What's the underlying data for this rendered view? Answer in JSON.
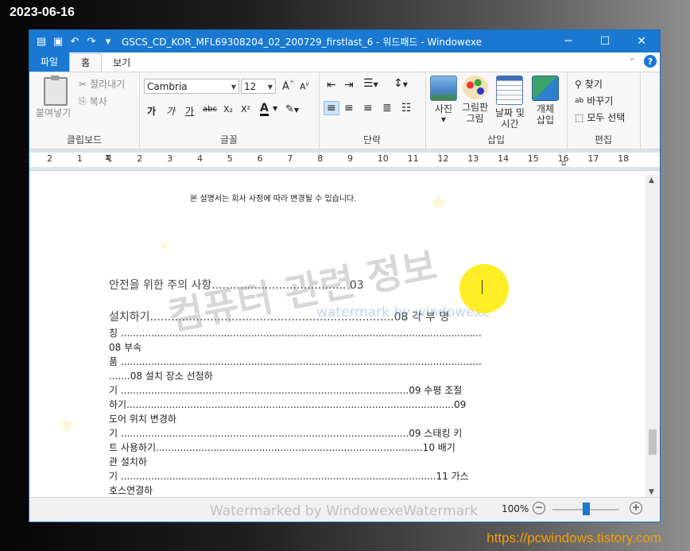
{
  "overlay": {
    "date": "2023-06-16",
    "site": "https://pcwindows.tistory.com",
    "watermark_big": "컴퓨터 관련 정보",
    "watermark_blue": "watermark by windowexe",
    "watermark_bottom": "Watermarked by WindowexeWatermark"
  },
  "window": {
    "title": "GSCS_CD_KOR_MFL69308204_02_200729_firstlast_6 - 워드패드    - Windowexe"
  },
  "icons": {
    "save": "save-icon",
    "undo": "undo-icon",
    "redo": "redo-icon",
    "minimize": "minimize-icon",
    "maximize": "maximize-icon",
    "close": "close-icon"
  },
  "tabs": [
    {
      "label": "파일"
    },
    {
      "label": "홈"
    },
    {
      "label": "보기"
    }
  ],
  "ribbon": {
    "clipboard": {
      "paste": "붙여넣기",
      "cut": "잘라내기",
      "copy": "복사",
      "label": "클립보드"
    },
    "font": {
      "family": "Cambria",
      "size": "12",
      "bold": "가",
      "italic": "가",
      "underline": "가",
      "strike": "abc",
      "subscript": "X₂",
      "superscript": "X²",
      "color": "A",
      "label": "글꼴"
    },
    "paragraph": {
      "label": "단락"
    },
    "insert": {
      "picture": "사진",
      "paint_line1": "그림판",
      "paint_line2": "그림",
      "datetime_line1": "날짜 및",
      "datetime_line2": "시간",
      "object_line1": "개체",
      "object_line2": "삽입",
      "label": "삽입"
    },
    "editing": {
      "find": "찾기",
      "replace": "바꾸기",
      "select_all": "모두 선택",
      "label": "편집"
    }
  },
  "ruler": {
    "numbers": [
      "2",
      "1",
      "1",
      "2",
      "3",
      "4",
      "5",
      "6",
      "7",
      "8",
      "9",
      "10",
      "11",
      "12",
      "13",
      "14",
      "15",
      "16",
      "17",
      "18"
    ]
  },
  "document": {
    "note": "본 설명서는 회사 사정에 따라 변경될 수 있습니다.",
    "lines": [
      "안전을 위한 주의 사항...................................... 03",
      "설치하기.....................................................................08 각 부 명",
      "칭 .......................................................................................................................",
      "08 부속",
      "품 .......................................................................................................................",
      ".......08 설치 장소 선정하",
      "기 ...............................................................................................09 수평 조절",
      "하기............................................................................................................09",
      "도어 위치 변경하",
      "기 ...............................................................................................09 스태킹 키",
      "트 사용하기........................................................................................10 배기",
      "관 설치하",
      "기 ........................................................................................................11 가스",
      "호스연결하"
    ]
  },
  "status": {
    "zoom": "100%",
    "zoom_level": 0.5
  }
}
